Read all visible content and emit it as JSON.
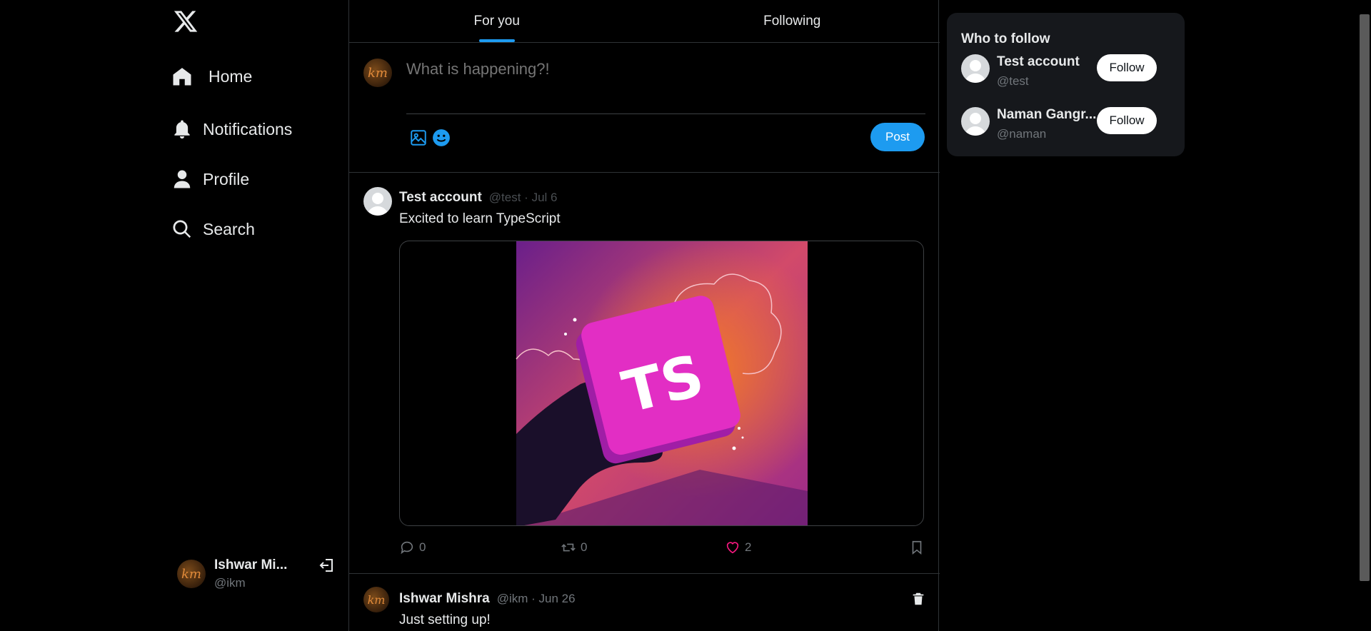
{
  "sidebar": {
    "logo": "x-logo-icon",
    "nav": [
      {
        "label": "Home",
        "icon": "home-icon"
      },
      {
        "label": "Notifications",
        "icon": "bell-icon"
      },
      {
        "label": "Profile",
        "icon": "user-icon"
      },
      {
        "label": "Search",
        "icon": "search-icon"
      }
    ],
    "account": {
      "name": "Ishwar Mi...",
      "handle": "@ikm",
      "avatar_initials": "km"
    }
  },
  "main": {
    "tabs": [
      {
        "label": "For you",
        "active": true
      },
      {
        "label": "Following",
        "active": false
      }
    ],
    "composer": {
      "placeholder": "What is happening?!",
      "post_label": "Post"
    },
    "tweets": [
      {
        "name": "Test account",
        "handle": "@test",
        "date": "Jul 6",
        "text": "Excited to learn TypeScript",
        "media_text": "TS",
        "replies": "0",
        "retweets": "0",
        "likes": "2"
      },
      {
        "name": "Ishwar Mishra",
        "handle": "@ikm",
        "date": "Jun 26",
        "text": "Just setting up!"
      }
    ]
  },
  "right": {
    "title": "Who to follow",
    "users": [
      {
        "name": "Test account",
        "handle": "@test",
        "button": "Follow"
      },
      {
        "name": "Naman Gangr...",
        "handle": "@naman",
        "button": "Follow"
      }
    ]
  },
  "colors": {
    "accent": "#1d9bf0",
    "background": "#000000",
    "panel": "#16181c",
    "like": "#f91880"
  }
}
